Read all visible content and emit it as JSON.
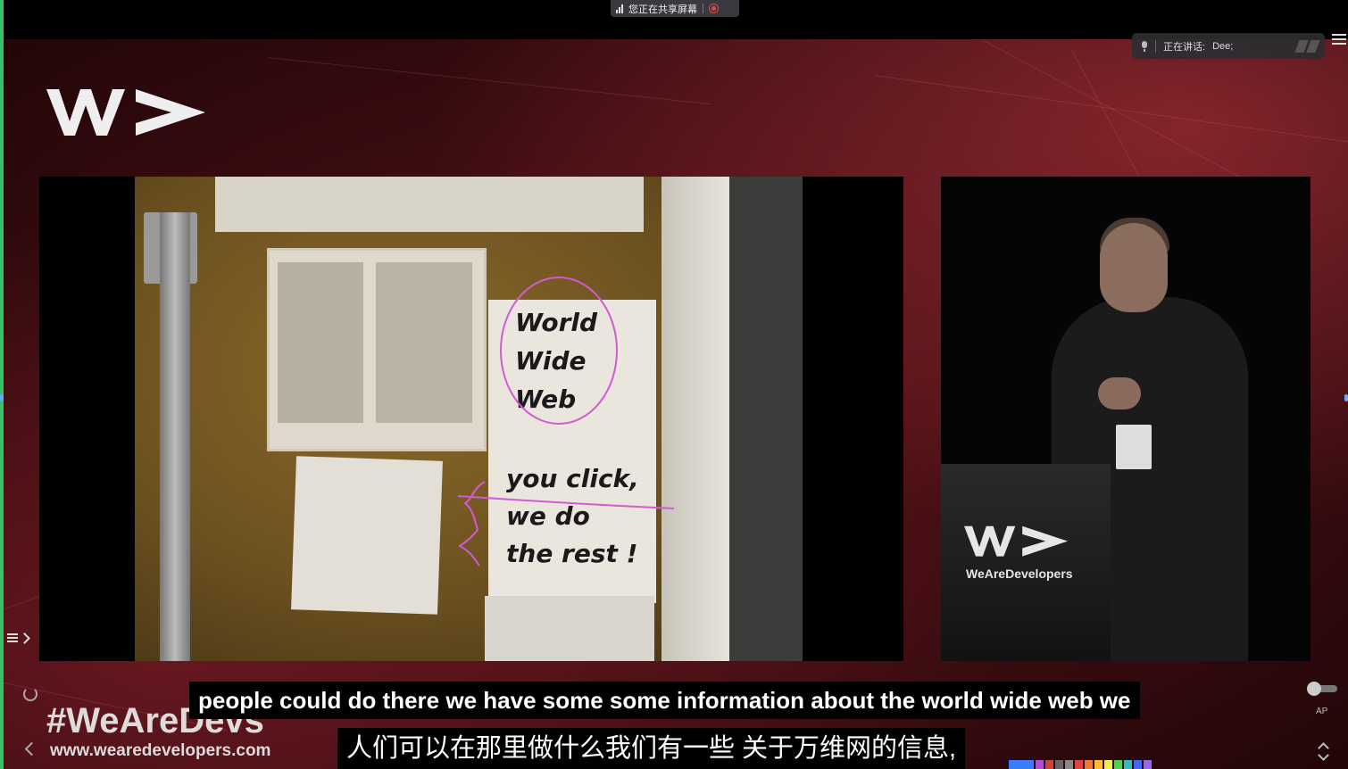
{
  "share_bar": {
    "label": "您正在共享屏幕"
  },
  "speaking": {
    "label": "正在讲话:",
    "name": "Dee;"
  },
  "slide": {
    "poster_line1": "World",
    "poster_line2": "Wide",
    "poster_line3": "Web",
    "poster_line4": "you click,",
    "poster_line5": "we do",
    "poster_line6": "the rest !"
  },
  "podium": {
    "brand": "WeAreDevelopers"
  },
  "overlay": {
    "hashtag": "#WeAreDevs",
    "url": "www.wearedevelopers.com"
  },
  "subtitles": {
    "english": "people could do there we have some some information about the world wide web we",
    "chinese": "人们可以在那里做什么我们有一些 关于万维网的信息,"
  },
  "controls": {
    "ap_label": "AP"
  },
  "colors": {
    "annotation": "#d25ad2",
    "share_stop": "#e04848",
    "edge_indicator": "#39c16a"
  },
  "icons": [
    "signal-icon",
    "stop-share-icon",
    "mic-icon",
    "menu-icon",
    "list-icon",
    "chevron-right-icon",
    "refresh-icon",
    "chevron-left-icon",
    "toggle-icon",
    "up-down-icon",
    "wad-logo-icon"
  ]
}
